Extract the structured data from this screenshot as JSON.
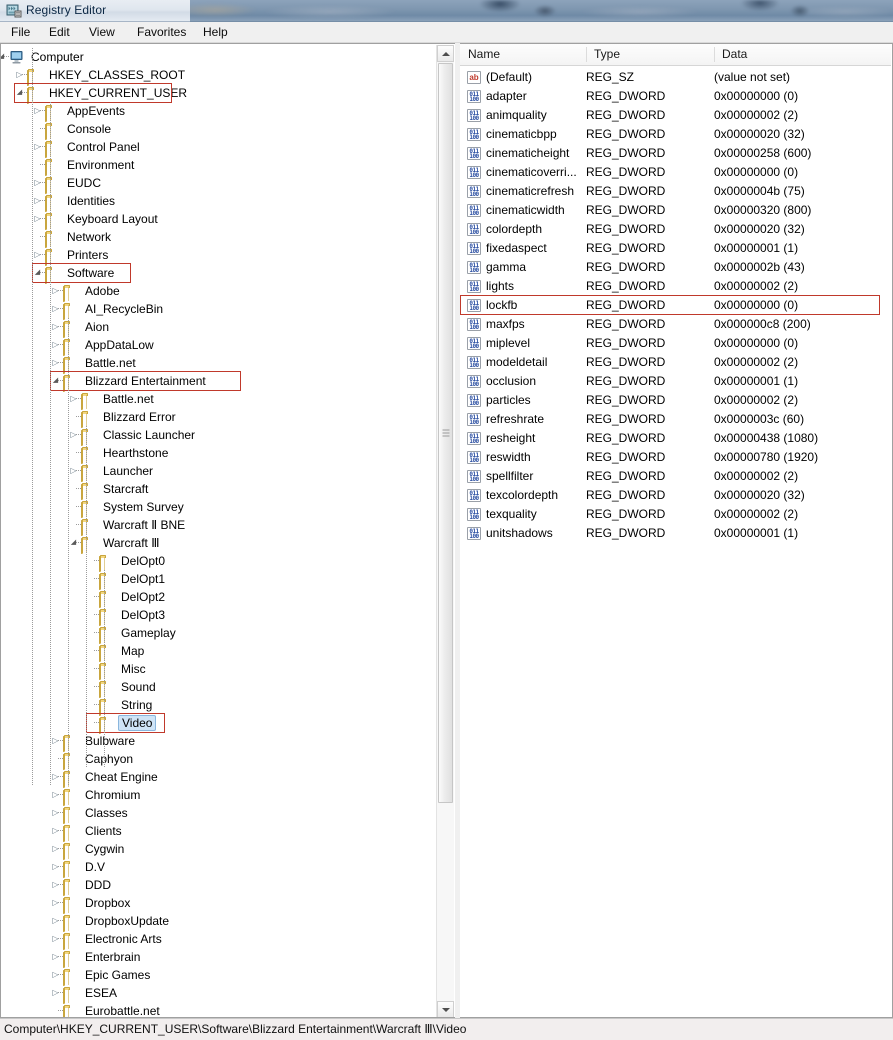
{
  "window": {
    "title": "Registry Editor",
    "icon": "registry-editor-icon"
  },
  "menu": {
    "items": [
      {
        "label": "File"
      },
      {
        "label": "Edit"
      },
      {
        "label": "View"
      },
      {
        "label": "Favorites"
      },
      {
        "label": "Help"
      }
    ]
  },
  "tree": {
    "nodes": [
      {
        "label": "Computer",
        "depth": 0,
        "state": "expanded",
        "icon": "computer-icon",
        "highlight": false,
        "selected": false
      },
      {
        "label": "HKEY_CLASSES_ROOT",
        "depth": 1,
        "state": "collapsed",
        "icon": "folder-icon",
        "highlight": false,
        "selected": false
      },
      {
        "label": "HKEY_CURRENT_USER",
        "depth": 1,
        "state": "expanded",
        "icon": "folder-icon",
        "highlight": true,
        "selected": false
      },
      {
        "label": "AppEvents",
        "depth": 2,
        "state": "collapsed",
        "icon": "folder-icon",
        "highlight": false,
        "selected": false
      },
      {
        "label": "Console",
        "depth": 2,
        "state": "leaf",
        "icon": "folder-icon",
        "highlight": false,
        "selected": false
      },
      {
        "label": "Control Panel",
        "depth": 2,
        "state": "collapsed",
        "icon": "folder-icon",
        "highlight": false,
        "selected": false
      },
      {
        "label": "Environment",
        "depth": 2,
        "state": "leaf",
        "icon": "folder-icon",
        "highlight": false,
        "selected": false
      },
      {
        "label": "EUDC",
        "depth": 2,
        "state": "collapsed",
        "icon": "folder-icon",
        "highlight": false,
        "selected": false
      },
      {
        "label": "Identities",
        "depth": 2,
        "state": "collapsed",
        "icon": "folder-icon",
        "highlight": false,
        "selected": false
      },
      {
        "label": "Keyboard Layout",
        "depth": 2,
        "state": "collapsed",
        "icon": "folder-icon",
        "highlight": false,
        "selected": false
      },
      {
        "label": "Network",
        "depth": 2,
        "state": "leaf",
        "icon": "folder-icon",
        "highlight": false,
        "selected": false
      },
      {
        "label": "Printers",
        "depth": 2,
        "state": "collapsed",
        "icon": "folder-icon",
        "highlight": false,
        "selected": false
      },
      {
        "label": "Software",
        "depth": 2,
        "state": "expanded",
        "icon": "folder-icon",
        "highlight": true,
        "selected": false
      },
      {
        "label": "Adobe",
        "depth": 3,
        "state": "collapsed",
        "icon": "folder-icon",
        "highlight": false,
        "selected": false
      },
      {
        "label": "AI_RecycleBin",
        "depth": 3,
        "state": "collapsed",
        "icon": "folder-icon",
        "highlight": false,
        "selected": false
      },
      {
        "label": "Aion",
        "depth": 3,
        "state": "collapsed",
        "icon": "folder-icon",
        "highlight": false,
        "selected": false
      },
      {
        "label": "AppDataLow",
        "depth": 3,
        "state": "collapsed",
        "icon": "folder-icon",
        "highlight": false,
        "selected": false
      },
      {
        "label": "Battle.net",
        "depth": 3,
        "state": "collapsed",
        "icon": "folder-icon",
        "highlight": false,
        "selected": false
      },
      {
        "label": "Blizzard Entertainment",
        "depth": 3,
        "state": "expanded",
        "icon": "folder-icon",
        "highlight": true,
        "selected": false
      },
      {
        "label": "Battle.net",
        "depth": 4,
        "state": "collapsed",
        "icon": "folder-icon",
        "highlight": false,
        "selected": false
      },
      {
        "label": "Blizzard Error",
        "depth": 4,
        "state": "leaf",
        "icon": "folder-icon",
        "highlight": false,
        "selected": false
      },
      {
        "label": "Classic Launcher",
        "depth": 4,
        "state": "collapsed",
        "icon": "folder-icon",
        "highlight": false,
        "selected": false
      },
      {
        "label": "Hearthstone",
        "depth": 4,
        "state": "leaf",
        "icon": "folder-icon",
        "highlight": false,
        "selected": false
      },
      {
        "label": "Launcher",
        "depth": 4,
        "state": "collapsed",
        "icon": "folder-icon",
        "highlight": false,
        "selected": false
      },
      {
        "label": "Starcraft",
        "depth": 4,
        "state": "leaf",
        "icon": "folder-icon",
        "highlight": false,
        "selected": false
      },
      {
        "label": "System Survey",
        "depth": 4,
        "state": "leaf",
        "icon": "folder-icon",
        "highlight": false,
        "selected": false
      },
      {
        "label": "Warcraft Ⅱ BNE",
        "depth": 4,
        "state": "leaf",
        "icon": "folder-icon",
        "highlight": false,
        "selected": false
      },
      {
        "label": "Warcraft Ⅲ",
        "depth": 4,
        "state": "expanded",
        "icon": "folder-icon",
        "highlight": false,
        "selected": false
      },
      {
        "label": "DelOpt0",
        "depth": 5,
        "state": "leaf",
        "icon": "folder-icon",
        "highlight": false,
        "selected": false
      },
      {
        "label": "DelOpt1",
        "depth": 5,
        "state": "leaf",
        "icon": "folder-icon",
        "highlight": false,
        "selected": false
      },
      {
        "label": "DelOpt2",
        "depth": 5,
        "state": "leaf",
        "icon": "folder-icon",
        "highlight": false,
        "selected": false
      },
      {
        "label": "DelOpt3",
        "depth": 5,
        "state": "leaf",
        "icon": "folder-icon",
        "highlight": false,
        "selected": false
      },
      {
        "label": "Gameplay",
        "depth": 5,
        "state": "leaf",
        "icon": "folder-icon",
        "highlight": false,
        "selected": false
      },
      {
        "label": "Map",
        "depth": 5,
        "state": "leaf",
        "icon": "folder-icon",
        "highlight": false,
        "selected": false
      },
      {
        "label": "Misc",
        "depth": 5,
        "state": "leaf",
        "icon": "folder-icon",
        "highlight": false,
        "selected": false
      },
      {
        "label": "Sound",
        "depth": 5,
        "state": "leaf",
        "icon": "folder-icon",
        "highlight": false,
        "selected": false
      },
      {
        "label": "String",
        "depth": 5,
        "state": "leaf",
        "icon": "folder-icon",
        "highlight": false,
        "selected": false
      },
      {
        "label": "Video",
        "depth": 5,
        "state": "leaf",
        "icon": "folder-icon",
        "highlight": true,
        "selected": true
      },
      {
        "label": "Bulbware",
        "depth": 3,
        "state": "collapsed",
        "icon": "folder-icon",
        "highlight": false,
        "selected": false
      },
      {
        "label": "Caphyon",
        "depth": 3,
        "state": "leaf",
        "icon": "folder-icon",
        "highlight": false,
        "selected": false
      },
      {
        "label": "Cheat Engine",
        "depth": 3,
        "state": "collapsed",
        "icon": "folder-icon",
        "highlight": false,
        "selected": false
      },
      {
        "label": "Chromium",
        "depth": 3,
        "state": "collapsed",
        "icon": "folder-icon",
        "highlight": false,
        "selected": false
      },
      {
        "label": "Classes",
        "depth": 3,
        "state": "collapsed",
        "icon": "folder-icon",
        "highlight": false,
        "selected": false
      },
      {
        "label": "Clients",
        "depth": 3,
        "state": "collapsed",
        "icon": "folder-icon",
        "highlight": false,
        "selected": false
      },
      {
        "label": "Cygwin",
        "depth": 3,
        "state": "collapsed",
        "icon": "folder-icon",
        "highlight": false,
        "selected": false
      },
      {
        "label": "D.V",
        "depth": 3,
        "state": "collapsed",
        "icon": "folder-icon",
        "highlight": false,
        "selected": false
      },
      {
        "label": "DDD",
        "depth": 3,
        "state": "collapsed",
        "icon": "folder-icon",
        "highlight": false,
        "selected": false
      },
      {
        "label": "Dropbox",
        "depth": 3,
        "state": "collapsed",
        "icon": "folder-icon",
        "highlight": false,
        "selected": false
      },
      {
        "label": "DropboxUpdate",
        "depth": 3,
        "state": "collapsed",
        "icon": "folder-icon",
        "highlight": false,
        "selected": false
      },
      {
        "label": "Electronic Arts",
        "depth": 3,
        "state": "collapsed",
        "icon": "folder-icon",
        "highlight": false,
        "selected": false
      },
      {
        "label": "Enterbrain",
        "depth": 3,
        "state": "collapsed",
        "icon": "folder-icon",
        "highlight": false,
        "selected": false
      },
      {
        "label": "Epic Games",
        "depth": 3,
        "state": "collapsed",
        "icon": "folder-icon",
        "highlight": false,
        "selected": false
      },
      {
        "label": "ESEA",
        "depth": 3,
        "state": "collapsed",
        "icon": "folder-icon",
        "highlight": false,
        "selected": false
      },
      {
        "label": "Eurobattle.net",
        "depth": 3,
        "state": "leaf",
        "icon": "folder-icon",
        "highlight": false,
        "selected": false
      }
    ]
  },
  "list": {
    "columns": [
      {
        "label": "Name"
      },
      {
        "label": "Type"
      },
      {
        "label": "Data"
      }
    ],
    "rows": [
      {
        "name": "(Default)",
        "type": "REG_SZ",
        "data": "(value not set)",
        "icon": "string-value-icon",
        "highlight": false
      },
      {
        "name": "adapter",
        "type": "REG_DWORD",
        "data": "0x00000000 (0)",
        "icon": "dword-value-icon",
        "highlight": false
      },
      {
        "name": "animquality",
        "type": "REG_DWORD",
        "data": "0x00000002 (2)",
        "icon": "dword-value-icon",
        "highlight": false
      },
      {
        "name": "cinematicbpp",
        "type": "REG_DWORD",
        "data": "0x00000020 (32)",
        "icon": "dword-value-icon",
        "highlight": false
      },
      {
        "name": "cinematicheight",
        "type": "REG_DWORD",
        "data": "0x00000258 (600)",
        "icon": "dword-value-icon",
        "highlight": false
      },
      {
        "name": "cinematicoverri...",
        "type": "REG_DWORD",
        "data": "0x00000000 (0)",
        "icon": "dword-value-icon",
        "highlight": false
      },
      {
        "name": "cinematicrefresh",
        "type": "REG_DWORD",
        "data": "0x0000004b (75)",
        "icon": "dword-value-icon",
        "highlight": false
      },
      {
        "name": "cinematicwidth",
        "type": "REG_DWORD",
        "data": "0x00000320 (800)",
        "icon": "dword-value-icon",
        "highlight": false
      },
      {
        "name": "colordepth",
        "type": "REG_DWORD",
        "data": "0x00000020 (32)",
        "icon": "dword-value-icon",
        "highlight": false
      },
      {
        "name": "fixedaspect",
        "type": "REG_DWORD",
        "data": "0x00000001 (1)",
        "icon": "dword-value-icon",
        "highlight": false
      },
      {
        "name": "gamma",
        "type": "REG_DWORD",
        "data": "0x0000002b (43)",
        "icon": "dword-value-icon",
        "highlight": false
      },
      {
        "name": "lights",
        "type": "REG_DWORD",
        "data": "0x00000002 (2)",
        "icon": "dword-value-icon",
        "highlight": false
      },
      {
        "name": "lockfb",
        "type": "REG_DWORD",
        "data": "0x00000000 (0)",
        "icon": "dword-value-icon",
        "highlight": true
      },
      {
        "name": "maxfps",
        "type": "REG_DWORD",
        "data": "0x000000c8 (200)",
        "icon": "dword-value-icon",
        "highlight": false
      },
      {
        "name": "miplevel",
        "type": "REG_DWORD",
        "data": "0x00000000 (0)",
        "icon": "dword-value-icon",
        "highlight": false
      },
      {
        "name": "modeldetail",
        "type": "REG_DWORD",
        "data": "0x00000002 (2)",
        "icon": "dword-value-icon",
        "highlight": false
      },
      {
        "name": "occlusion",
        "type": "REG_DWORD",
        "data": "0x00000001 (1)",
        "icon": "dword-value-icon",
        "highlight": false
      },
      {
        "name": "particles",
        "type": "REG_DWORD",
        "data": "0x00000002 (2)",
        "icon": "dword-value-icon",
        "highlight": false
      },
      {
        "name": "refreshrate",
        "type": "REG_DWORD",
        "data": "0x0000003c (60)",
        "icon": "dword-value-icon",
        "highlight": false
      },
      {
        "name": "resheight",
        "type": "REG_DWORD",
        "data": "0x00000438 (1080)",
        "icon": "dword-value-icon",
        "highlight": false
      },
      {
        "name": "reswidth",
        "type": "REG_DWORD",
        "data": "0x00000780 (1920)",
        "icon": "dword-value-icon",
        "highlight": false
      },
      {
        "name": "spellfilter",
        "type": "REG_DWORD",
        "data": "0x00000002 (2)",
        "icon": "dword-value-icon",
        "highlight": false
      },
      {
        "name": "texcolordepth",
        "type": "REG_DWORD",
        "data": "0x00000020 (32)",
        "icon": "dword-value-icon",
        "highlight": false
      },
      {
        "name": "texquality",
        "type": "REG_DWORD",
        "data": "0x00000002 (2)",
        "icon": "dword-value-icon",
        "highlight": false
      },
      {
        "name": "unitshadows",
        "type": "REG_DWORD",
        "data": "0x00000001 (1)",
        "icon": "dword-value-icon",
        "highlight": false
      }
    ]
  },
  "statusbar": {
    "path": "Computer\\HKEY_CURRENT_USER\\Software\\Blizzard Entertainment\\Warcraft Ⅲ\\Video"
  },
  "colors": {
    "annotation": "#c0392b",
    "selection": "#cfe4f7",
    "selection_border": "#8ab6dd",
    "folder": "#f7dd8c",
    "string_icon": "#c0392b",
    "dword_icon": "#2b4fa2"
  }
}
